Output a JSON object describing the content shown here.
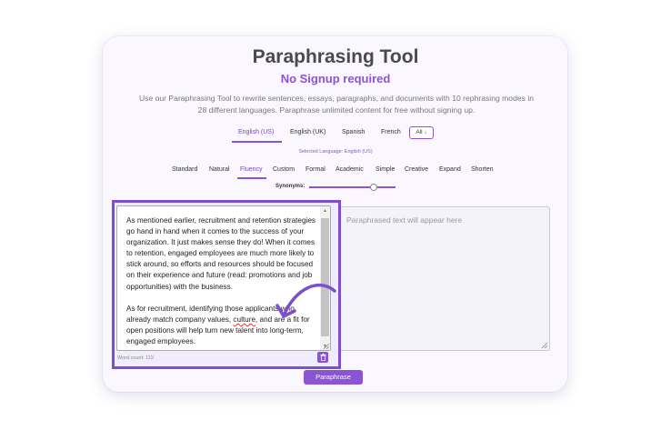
{
  "header": {
    "title": "Paraphrasing Tool",
    "subtitle": "No Signup required",
    "description": "Use our Paraphrasing Tool to rewrite sentences, essays, paragraphs, and documents with 10 rephrasing modes in 28 different languages. Paraphrase unlimited content for free without signing up."
  },
  "languages": {
    "items": [
      "English (US)",
      "English (UK)",
      "Spanish",
      "French"
    ],
    "all_label": "All ↓",
    "selected_text": "Selected Language: English (US)"
  },
  "modes": {
    "items": [
      "Standard",
      "Natural",
      "Fluency",
      "Custom",
      "Formal",
      "Academic",
      "Simple",
      "Creative",
      "Expand",
      "Shorten"
    ],
    "active": "Fluency"
  },
  "synonyms": {
    "label": "Synonyms:",
    "level": 0.7
  },
  "input": {
    "paragraph1": "As mentioned earlier, recruitment and retention strategies go hand in hand when it comes to the success of your organization. It just makes sense they do! When it comes to retention, engaged employees are much more likely to stick around, so efforts and resources should be focused on their experience and future (read: promotions and job opportunities) with the business.",
    "paragraph2_a": "As for recruitment, identifying those applicants who already match company values, ",
    "paragraph2_misspelled": "culture",
    "paragraph2_b": ", and are a fit for open positions will help turn new talent into long-term, engaged employees.",
    "word_count": "Word count: 113"
  },
  "output": {
    "placeholder": "Paraphrased text will appear here"
  },
  "actions": {
    "paraphrase_label": "Paraphrase"
  },
  "colors": {
    "accent": "#8a54d6",
    "highlight_border": "#7d4fd0"
  }
}
